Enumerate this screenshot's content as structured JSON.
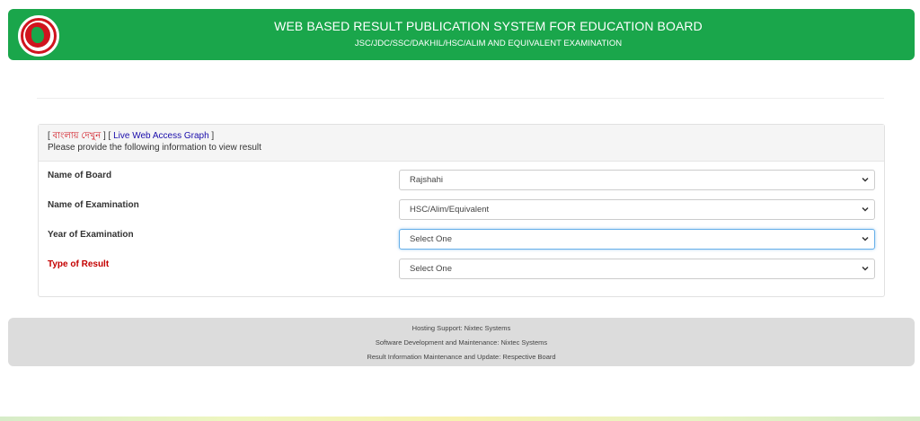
{
  "header": {
    "title": "WEB BASED RESULT PUBLICATION SYSTEM FOR EDUCATION BOARD",
    "subtitle": "JSC/JDC/SSC/DAKHIL/HSC/ALIM AND EQUIVALENT EXAMINATION",
    "logo_icon": "government-seal-icon"
  },
  "panel": {
    "bracket_open": "[ ",
    "bangla_link": "বাংলায় দেখুন",
    "separator": " ] [ ",
    "graph_link": "Live Web Access Graph",
    "bracket_close": " ]",
    "instruction": "Please provide the following information to view result"
  },
  "form": {
    "board": {
      "label": "Name of Board",
      "value": "Rajshahi"
    },
    "exam": {
      "label": "Name of Examination",
      "value": "HSC/Alim/Equivalent"
    },
    "year": {
      "label": "Year of Examination",
      "value": "Select One"
    },
    "type": {
      "label": "Type of Result",
      "value": "Select One"
    }
  },
  "footer": {
    "hosting": "Hosting Support: Nixtec Systems",
    "software": "Software Development and Maintenance: Nixtec Systems",
    "result_info": "Result Information Maintenance and Update: Respective Board"
  },
  "colors": {
    "header_bg": "#1aa64b",
    "required_label": "#c40000",
    "link": "#1a0dab",
    "bangla_link": "#d0141e"
  }
}
